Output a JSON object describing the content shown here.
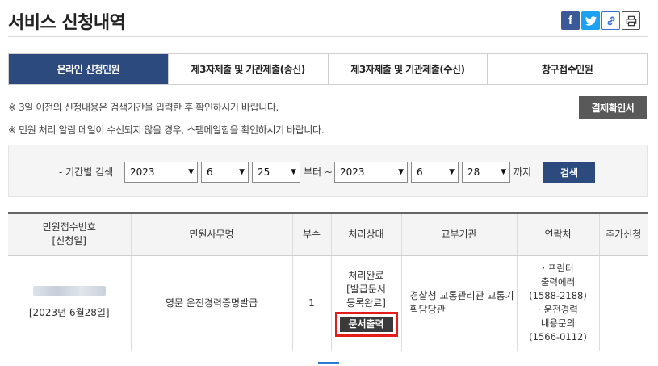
{
  "header": {
    "title": "서비스 신청내역",
    "share": {
      "facebook": "facebook-icon",
      "twitter": "twitter-icon",
      "link": "link-icon",
      "print": "print-icon"
    }
  },
  "tabs": [
    {
      "label": "온라인 신청민원",
      "active": true
    },
    {
      "label": "제3자제출 및 기관제출(송신)",
      "active": false
    },
    {
      "label": "제3자제출 및 기관제출(수신)",
      "active": false
    },
    {
      "label": "창구접수민원",
      "active": false
    }
  ],
  "notices": {
    "line1": "※ 3일 이전의 신청내용은 검색기간을 입력한 후 확인하시기 바랍니다.",
    "line2": "※ 민원 처리 알림 메일이 수신되지 않을 경우, 스팸메일함을 확인하시기 바랍니다."
  },
  "receipt_button": "결제확인서",
  "search": {
    "label": "- 기간별 검색",
    "from_year": "2023",
    "from_month": "6",
    "from_day": "25",
    "from_suffix": "부터 ~",
    "to_year": "2023",
    "to_month": "6",
    "to_day": "28",
    "to_suffix": "까지",
    "button": "검색"
  },
  "table": {
    "headers": {
      "receipt_no_line1": "민원접수번호",
      "receipt_no_line2": "[신청일]",
      "service_name": "민원사무명",
      "copies": "부수",
      "status": "처리상태",
      "agency": "교부기관",
      "contact": "연락처",
      "extra": "추가신청"
    },
    "rows": [
      {
        "date": "[2023년 6월28일]",
        "service_name": "영문 운전경력증명발급",
        "copies": "1",
        "status_line1": "처리완료",
        "status_line2": "[발급문서",
        "status_line3": "등록완료]",
        "doc_button": "문서출력",
        "agency_line1": "경찰청 교통관리관 교통기",
        "agency_line2": "획담당관",
        "contact_lines": [
          "· 프린터",
          "출력에러",
          "(1588-2188)",
          "· 운전경력",
          "내용문의",
          "(1566-0112)"
        ],
        "extra": ""
      }
    ]
  }
}
